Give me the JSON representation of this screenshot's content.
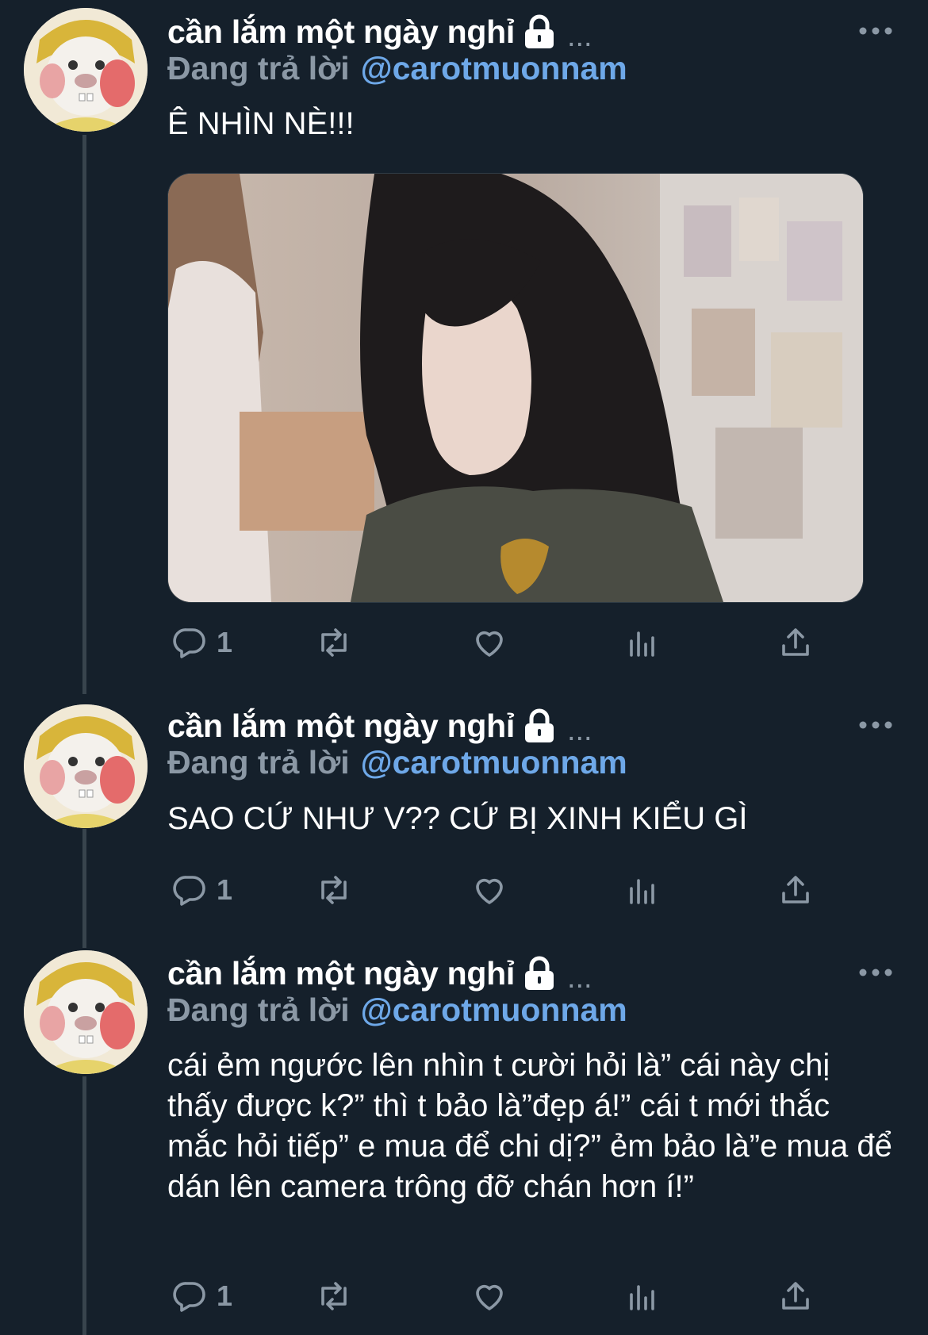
{
  "colors": {
    "background": "#15202b",
    "thread_line": "#38444d",
    "secondary_text": "#8b98a5",
    "handle_link": "#6ea8e8",
    "text": "#ffffff"
  },
  "tweets": [
    {
      "display_name": "cần lắm một ngày nghỉ",
      "name_truncation": "...",
      "reply_prefix": "Đang trả lời",
      "reply_handle": "@carotmuonnam",
      "text": "Ê NHÌN NÈ!!!",
      "has_media": true,
      "reply_count": "1"
    },
    {
      "display_name": "cần lắm một ngày nghỉ",
      "name_truncation": "...",
      "reply_prefix": "Đang trả lời",
      "reply_handle": "@carotmuonnam",
      "text": "SAO CỨ NHƯ V?? CỨ BỊ XINH KIỂU GÌ",
      "has_media": false,
      "reply_count": "1"
    },
    {
      "display_name": "cần lắm một ngày nghỉ",
      "name_truncation": "...",
      "reply_prefix": "Đang trả lời",
      "reply_handle": "@carotmuonnam",
      "text": "cái ẻm ngước lên nhìn t cười hỏi là” cái này chị thấy được k?” thì t bảo là”đẹp á!” cái t mới thắc mắc hỏi tiếp” e mua để chi dị?” ẻm bảo là”e mua để dán lên camera trông đỡ chán hơn í!”",
      "has_media": false,
      "reply_count": "1"
    }
  ],
  "icons": {
    "lock": "lock-icon",
    "more": "more-icon",
    "reply": "reply-icon",
    "retweet": "retweet-icon",
    "like": "heart-icon",
    "views": "views-icon",
    "share": "share-icon"
  }
}
